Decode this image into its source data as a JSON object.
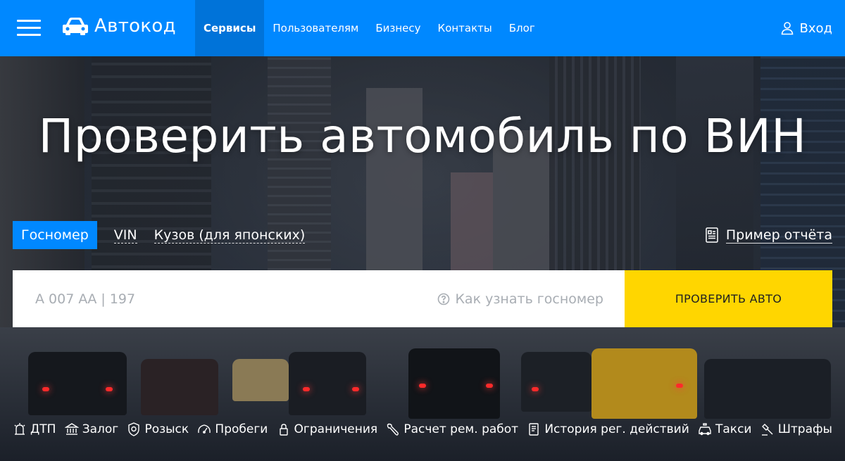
{
  "header": {
    "logo_text": "Автокод",
    "nav": [
      "Сервисы",
      "Пользователям",
      "Бизнесу",
      "Контакты",
      "Блог"
    ],
    "login_label": "Вход",
    "brand_color": "#0088ff"
  },
  "hero": {
    "title": "Проверить автомобиль по ВИН",
    "tabs": [
      "Госномер",
      "VIN",
      "Кузов (для японских)"
    ],
    "sample_report": "Пример отчёта",
    "search": {
      "placeholder": "А 007 АА | 197",
      "hint": "Как узнать госномер",
      "button": "ПРОВЕРИТЬ АВТО",
      "button_color": "#ffd600"
    }
  },
  "services": [
    {
      "label": "ДТП",
      "icon": "accident-icon"
    },
    {
      "label": "Залог",
      "icon": "bank-icon"
    },
    {
      "label": "Розыск",
      "icon": "badge-icon"
    },
    {
      "label": "Пробеги",
      "icon": "speedometer-icon"
    },
    {
      "label": "Ограничения",
      "icon": "lock-icon"
    },
    {
      "label": "Расчет рем. работ",
      "icon": "wrench-icon"
    },
    {
      "label": "История рег. действий",
      "icon": "document-icon"
    },
    {
      "label": "Такси",
      "icon": "taxi-icon"
    },
    {
      "label": "Штрафы",
      "icon": "gavel-icon"
    }
  ]
}
